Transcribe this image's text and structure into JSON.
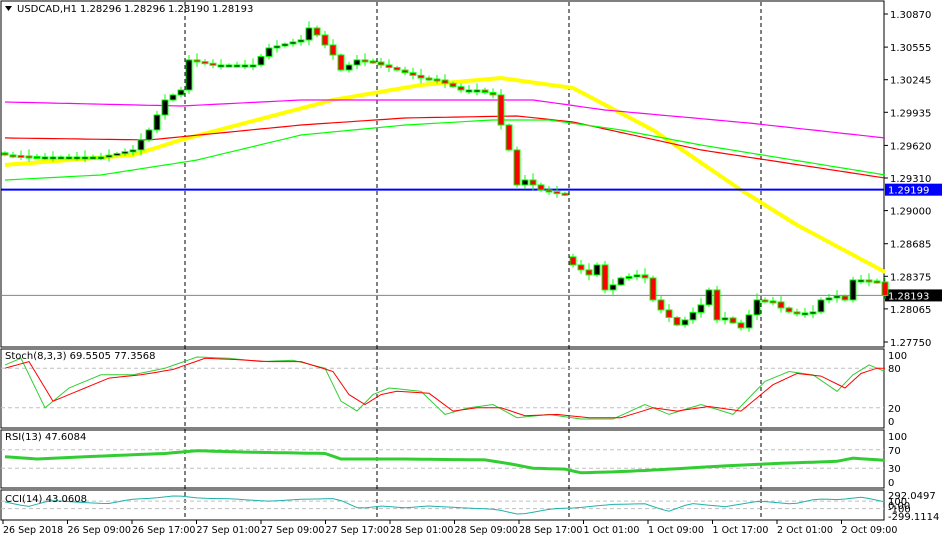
{
  "header": {
    "symbol": "USDCAD,H1",
    "open": "1.28296",
    "high": "1.28296",
    "low": "1.28190",
    "close": "1.28193"
  },
  "colors": {
    "bull_body": "#000000",
    "bear_body": "#ff0000",
    "outline": "#00ff00",
    "ma_yellow": "#ffff00",
    "ma_magenta": "#ff00ff",
    "ma_red": "#ff0000",
    "ma_green": "#00ff00",
    "hline": "#0000ff",
    "stoch_main": "#32cd32",
    "stoch_signal": "#ff0000",
    "rsi": "#32cd32",
    "cci": "#20b2aa"
  },
  "chart_data": [
    {
      "type": "candlestick",
      "title": "USDCAD,H1",
      "ylim": [
        1.2775,
        1.3087
      ],
      "y_ticks": [
        "1.30870",
        "1.30555",
        "1.30245",
        "1.29935",
        "1.29620",
        "1.29310",
        "1.29000",
        "1.28685",
        "1.28375",
        "1.28065",
        "1.27750"
      ],
      "close_keypoints": [
        [
          0,
          1.29529
        ],
        [
          4,
          1.2951
        ],
        [
          12,
          1.2951
        ],
        [
          16,
          1.29577
        ],
        [
          18,
          1.29767
        ],
        [
          20,
          1.30052
        ],
        [
          22,
          1.30147
        ],
        [
          23,
          1.30433
        ],
        [
          26,
          1.30385
        ],
        [
          31,
          1.30385
        ],
        [
          33,
          1.30547
        ],
        [
          37,
          1.30623
        ],
        [
          38,
          1.30737
        ],
        [
          39,
          1.3067
        ],
        [
          41,
          1.3048
        ],
        [
          42,
          1.30337
        ],
        [
          43,
          1.30385
        ],
        [
          44,
          1.30433
        ],
        [
          46,
          1.30413
        ],
        [
          47,
          1.30385
        ],
        [
          49,
          1.30337
        ],
        [
          52,
          1.30261
        ],
        [
          54,
          1.30242
        ],
        [
          57,
          1.30147
        ],
        [
          59,
          1.30147
        ],
        [
          61,
          1.301
        ],
        [
          62,
          1.29814
        ],
        [
          63,
          1.29577
        ],
        [
          64,
          1.29244
        ],
        [
          65,
          1.29291
        ],
        [
          66,
          1.29244
        ],
        [
          67,
          1.29196
        ],
        [
          70,
          1.29149
        ],
        [
          71,
          1.28483
        ],
        [
          72,
          1.28436
        ],
        [
          73,
          1.28388
        ],
        [
          74,
          1.28483
        ],
        [
          75,
          1.28245
        ],
        [
          76,
          1.28293
        ],
        [
          77,
          1.28359
        ],
        [
          79,
          1.28388
        ],
        [
          80,
          1.28359
        ],
        [
          81,
          1.2815
        ],
        [
          82,
          1.28055
        ],
        [
          84,
          1.27912
        ],
        [
          85,
          1.2796
        ],
        [
          87,
          1.28103
        ],
        [
          88,
          1.28245
        ],
        [
          89,
          1.2796
        ],
        [
          90,
          1.27979
        ],
        [
          92,
          1.27884
        ],
        [
          93,
          1.28008
        ],
        [
          94,
          1.2815
        ],
        [
          96,
          1.28131
        ],
        [
          97,
          1.28074
        ],
        [
          98,
          1.28036
        ],
        [
          99,
          1.28017
        ],
        [
          101,
          1.28036
        ],
        [
          102,
          1.2815
        ],
        [
          104,
          1.28188
        ],
        [
          105,
          1.2815
        ],
        [
          106,
          1.2834
        ],
        [
          107,
          1.2834
        ],
        [
          109,
          1.28321
        ],
        [
          110,
          1.28193
        ]
      ],
      "moving_averages": [
        {
          "name": "yellow",
          "color": "#ffff00",
          "points": [
            [
              0,
              1.29434
            ],
            [
              16,
              1.29529
            ],
            [
              22,
              1.29672
            ],
            [
              41,
              1.30052
            ],
            [
              52,
              1.30195
            ],
            [
              62,
              1.30261
            ],
            [
              71,
              1.30166
            ],
            [
              81,
              1.29767
            ],
            [
              92,
              1.29196
            ],
            [
              99,
              1.28863
            ],
            [
              110,
              1.28416
            ]
          ]
        },
        {
          "name": "magenta",
          "color": "#ff00ff",
          "points": [
            [
              0,
              1.30033
            ],
            [
              22,
              1.29995
            ],
            [
              37,
              1.30052
            ],
            [
              66,
              1.30052
            ],
            [
              75,
              1.29957
            ],
            [
              93,
              1.29833
            ],
            [
              110,
              1.29691
            ]
          ]
        },
        {
          "name": "red",
          "color": "#ff0000",
          "points": [
            [
              0,
              1.29691
            ],
            [
              18,
              1.29672
            ],
            [
              37,
              1.29814
            ],
            [
              50,
              1.29881
            ],
            [
              64,
              1.299
            ],
            [
              71,
              1.29843
            ],
            [
              87,
              1.29577
            ],
            [
              110,
              1.2931
            ]
          ]
        },
        {
          "name": "green",
          "color": "#00ff00",
          "points": [
            [
              0,
              1.29291
            ],
            [
              12,
              1.29339
            ],
            [
              24,
              1.29481
            ],
            [
              37,
              1.29719
            ],
            [
              50,
              1.29814
            ],
            [
              61,
              1.29862
            ],
            [
              68,
              1.29862
            ],
            [
              77,
              1.29767
            ],
            [
              87,
              1.29624
            ],
            [
              110,
              1.29339
            ]
          ]
        }
      ],
      "hlines": [
        {
          "price": 1.29199,
          "label": "1.29199",
          "color": "#0000ff"
        },
        {
          "price": 1.28193,
          "label": "1.28193",
          "color": "#778899"
        }
      ],
      "vlines_at_bars": [
        23,
        47,
        71,
        95
      ],
      "x_ticks": [
        "26 Sep 2018",
        "26 Sep 09:00",
        "26 Sep 17:00",
        "27 Sep 01:00",
        "27 Sep 09:00",
        "27 Sep 17:00",
        "28 Sep 01:00",
        "28 Sep 09:00",
        "28 Sep 17:00",
        "1 Oct 01:00",
        "1 Oct 09:00",
        "1 Oct 17:00",
        "2 Oct 01:00",
        "2 Oct 09:00"
      ]
    },
    {
      "type": "line",
      "title": "Stoch(8,3,3) 69.5505 77.3568",
      "ylim": [
        0,
        100
      ],
      "y_ticks": [
        "100",
        "80",
        "20",
        "0"
      ],
      "levels": [
        80,
        20
      ],
      "series": [
        {
          "name": "main",
          "points": [
            [
              0,
              85
            ],
            [
              2,
              95
            ],
            [
              5,
              20
            ],
            [
              8,
              50
            ],
            [
              12,
              70
            ],
            [
              16,
              70
            ],
            [
              20,
              80
            ],
            [
              24,
              97
            ],
            [
              28,
              95
            ],
            [
              32,
              90
            ],
            [
              36,
              92
            ],
            [
              40,
              80
            ],
            [
              42,
              30
            ],
            [
              44,
              15
            ],
            [
              46,
              40
            ],
            [
              48,
              50
            ],
            [
              52,
              45
            ],
            [
              55,
              10
            ],
            [
              58,
              20
            ],
            [
              61,
              25
            ],
            [
              64,
              5
            ],
            [
              68,
              10
            ],
            [
              72,
              3
            ],
            [
              76,
              3
            ],
            [
              80,
              25
            ],
            [
              83,
              10
            ],
            [
              87,
              25
            ],
            [
              91,
              10
            ],
            [
              95,
              60
            ],
            [
              98,
              75
            ],
            [
              101,
              70
            ],
            [
              104,
              45
            ],
            [
              106,
              70
            ],
            [
              108,
              85
            ],
            [
              110,
              75
            ]
          ]
        },
        {
          "name": "signal",
          "points": [
            [
              0,
              80
            ],
            [
              3,
              90
            ],
            [
              6,
              30
            ],
            [
              9,
              45
            ],
            [
              13,
              65
            ],
            [
              17,
              70
            ],
            [
              21,
              78
            ],
            [
              25,
              95
            ],
            [
              29,
              93
            ],
            [
              33,
              90
            ],
            [
              37,
              90
            ],
            [
              41,
              75
            ],
            [
              43,
              40
            ],
            [
              45,
              25
            ],
            [
              47,
              40
            ],
            [
              49,
              45
            ],
            [
              53,
              42
            ],
            [
              56,
              15
            ],
            [
              59,
              20
            ],
            [
              62,
              20
            ],
            [
              65,
              8
            ],
            [
              69,
              10
            ],
            [
              73,
              5
            ],
            [
              77,
              5
            ],
            [
              81,
              20
            ],
            [
              84,
              15
            ],
            [
              88,
              22
            ],
            [
              92,
              15
            ],
            [
              96,
              55
            ],
            [
              99,
              72
            ],
            [
              102,
              68
            ],
            [
              105,
              50
            ],
            [
              107,
              72
            ],
            [
              109,
              80
            ],
            [
              110,
              80
            ]
          ]
        }
      ]
    },
    {
      "type": "line",
      "title": "RSI(13) 47.6084",
      "ylim": [
        0,
        100
      ],
      "y_ticks": [
        "100",
        "70",
        "30",
        "0"
      ],
      "levels": [
        70,
        30
      ],
      "series": [
        {
          "name": "rsi",
          "points": [
            [
              0,
              55
            ],
            [
              4,
              50
            ],
            [
              10,
              55
            ],
            [
              20,
              62
            ],
            [
              24,
              68
            ],
            [
              30,
              65
            ],
            [
              40,
              62
            ],
            [
              42,
              50
            ],
            [
              50,
              50
            ],
            [
              60,
              48
            ],
            [
              63,
              40
            ],
            [
              66,
              30
            ],
            [
              70,
              28
            ],
            [
              72,
              20
            ],
            [
              76,
              22
            ],
            [
              80,
              25
            ],
            [
              90,
              35
            ],
            [
              96,
              40
            ],
            [
              104,
              45
            ],
            [
              106,
              52
            ],
            [
              110,
              47
            ]
          ]
        }
      ]
    },
    {
      "type": "line",
      "title": "CCI(14) 43.0608",
      "ylim": [
        -299.1114,
        292.0497
      ],
      "y_ticks": [
        "292.0497",
        "100",
        "0.00",
        "-100",
        "-299.1114"
      ],
      "levels": [
        100,
        -100
      ],
      "series": [
        {
          "name": "cci",
          "points": [
            [
              0,
              80
            ],
            [
              4,
              -50
            ],
            [
              8,
              120
            ],
            [
              14,
              60
            ],
            [
              18,
              30
            ],
            [
              22,
              150
            ],
            [
              26,
              180
            ],
            [
              30,
              250
            ],
            [
              34,
              180
            ],
            [
              40,
              160
            ],
            [
              46,
              100
            ],
            [
              52,
              150
            ],
            [
              58,
              170
            ],
            [
              62,
              -100
            ],
            [
              66,
              -30
            ],
            [
              70,
              -80
            ],
            [
              74,
              -30
            ],
            [
              80,
              -80
            ],
            [
              86,
              -120
            ],
            [
              90,
              -260
            ],
            [
              96,
              -100
            ],
            [
              100,
              -80
            ],
            [
              106,
              10
            ],
            [
              112,
              30
            ],
            [
              116,
              -180
            ],
            [
              120,
              40
            ],
            [
              126,
              -50
            ],
            [
              132,
              100
            ],
            [
              138,
              20
            ],
            [
              142,
              160
            ],
            [
              146,
              140
            ],
            [
              150,
              210
            ],
            [
              154,
              80
            ]
          ]
        }
      ]
    }
  ]
}
